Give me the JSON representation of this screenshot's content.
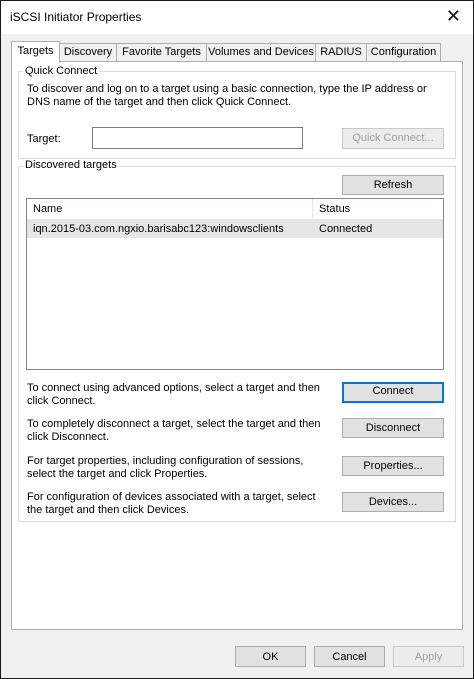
{
  "window": {
    "title": "iSCSI Initiator Properties",
    "close_glyph": "✕"
  },
  "tabs": [
    {
      "label": "Targets"
    },
    {
      "label": "Discovery"
    },
    {
      "label": "Favorite Targets"
    },
    {
      "label": "Volumes and Devices"
    },
    {
      "label": "RADIUS"
    },
    {
      "label": "Configuration"
    }
  ],
  "quick_connect": {
    "legend": "Quick Connect",
    "description": "To discover and log on to a target using a basic connection, type the IP address or DNS name of the target and then click Quick Connect.",
    "target_label": "Target:",
    "target_value": "",
    "button": "Quick Connect..."
  },
  "discovered": {
    "legend": "Discovered targets",
    "refresh_button": "Refresh",
    "columns": [
      "Name",
      "Status"
    ],
    "rows": [
      {
        "name": "iqn.2015-03.com.ngxio.barisabc123:windowsclients",
        "status": "Connected"
      }
    ]
  },
  "actions": [
    {
      "text": "To connect using advanced options, select a target and then click Connect.",
      "button": "Connect"
    },
    {
      "text": "To completely disconnect a target, select the target and then click Disconnect.",
      "button": "Disconnect"
    },
    {
      "text": "For target properties, including configuration of sessions, select the target and click Properties.",
      "button": "Properties..."
    },
    {
      "text": "For configuration of devices associated with a target, select the target and then click Devices.",
      "button": "Devices..."
    }
  ],
  "footer": {
    "ok": "OK",
    "cancel": "Cancel",
    "apply": "Apply"
  }
}
